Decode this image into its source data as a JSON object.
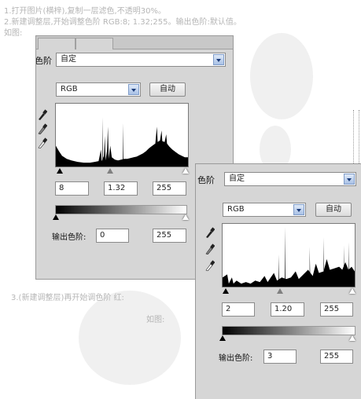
{
  "tutorial": {
    "line1": "1.打开图片(横梓),复制一层滤色,不透明30%。",
    "line2": "2.新建调整层,开始调整色阶 RGB:8; 1.32;255。输出色阶:默认值。",
    "line3": "如图:",
    "line4": "3.(新建调整层)再开始调色阶 红:",
    "line5": "如图:"
  },
  "panel_back": {
    "preset_label": "色阶",
    "preset_value": "自定",
    "channel_value": "RGB",
    "auto_label": "自动",
    "input_black": "8",
    "input_gamma": "1.32",
    "input_white": "255",
    "output_label": "输出色阶:",
    "output_black": "0",
    "output_white": "255"
  },
  "panel_front": {
    "preset_label": "色阶",
    "preset_value": "自定",
    "channel_value": "RGB",
    "auto_label": "自动",
    "input_black": "2",
    "input_gamma": "1.20",
    "input_white": "255",
    "output_label": "输出色阶:",
    "output_black": "3",
    "output_white": "255"
  },
  "icons": {
    "eyedropper_black": "eyedropper-black-icon",
    "eyedropper_gray": "eyedropper-gray-icon",
    "eyedropper_white": "eyedropper-white-icon",
    "dropdown": "chevron-down-icon"
  },
  "colors": {
    "panel_bg": "#d6d6d6",
    "tutorial_text": "#b6b6b6",
    "dropdown_accent": "#1c3c7a"
  }
}
